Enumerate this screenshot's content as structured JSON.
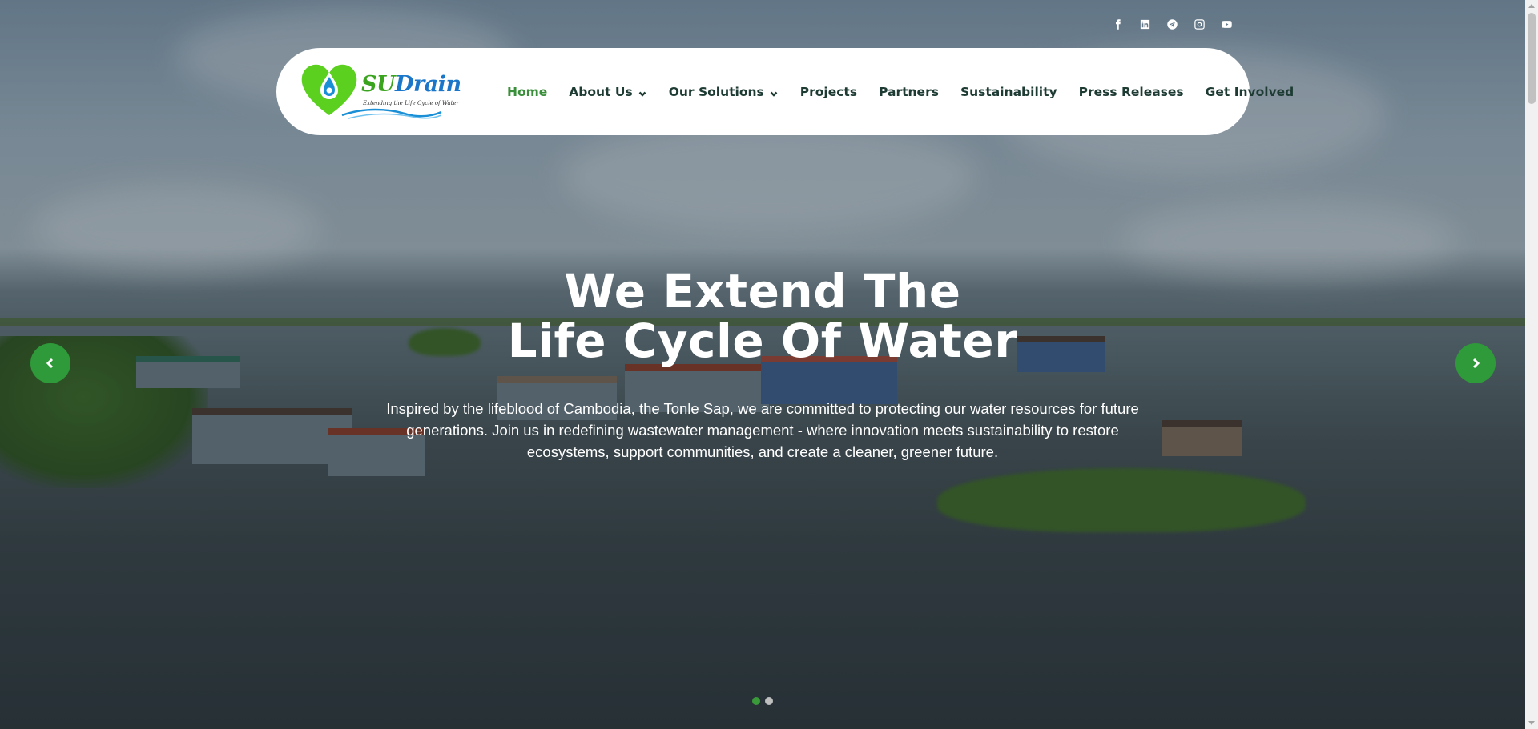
{
  "social": [
    {
      "icon": "facebook-icon"
    },
    {
      "icon": "linkedin-icon"
    },
    {
      "icon": "telegram-icon"
    },
    {
      "icon": "instagram-icon"
    },
    {
      "icon": "youtube-icon"
    }
  ],
  "logo": {
    "brand_su": "SU",
    "brand_drain": "Drain",
    "tagline": "Extending the Life Cycle of Water"
  },
  "nav": {
    "items": [
      {
        "label": "Home",
        "active": true,
        "dropdown": false
      },
      {
        "label": "About Us",
        "active": false,
        "dropdown": true
      },
      {
        "label": "Our Solutions",
        "active": false,
        "dropdown": true
      },
      {
        "label": "Projects",
        "active": false,
        "dropdown": false
      },
      {
        "label": "Partners",
        "active": false,
        "dropdown": false
      },
      {
        "label": "Sustainability",
        "active": false,
        "dropdown": false
      },
      {
        "label": "Press Releases",
        "active": false,
        "dropdown": false
      },
      {
        "label": "Get Involved",
        "active": false,
        "dropdown": false
      }
    ]
  },
  "hero": {
    "headline_line1": "We Extend The",
    "headline_line2": "Life Cycle Of Water",
    "description": "Inspired by the lifeblood of Cambodia, the Tonle Sap, we are committed to protecting our water resources for future generations. Join us in redefining wastewater management - where innovation meets sustainability to restore ecosystems, support communities, and create a cleaner, greener future."
  },
  "slider": {
    "total": 2,
    "active_index": 0
  },
  "colors": {
    "accent_green": "#2f9a3a",
    "nav_text": "#1d3b33",
    "active_nav": "#3a8f3a",
    "brand_blue": "#1a76c9"
  }
}
